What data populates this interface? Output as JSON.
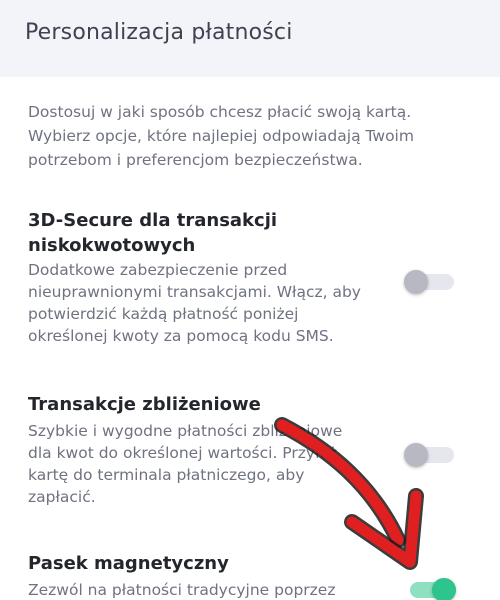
{
  "header": {
    "title": "Personalizacja płatności"
  },
  "intro": {
    "text": "Dostosuj w jaki sposób chcesz płacić swoją kartą. Wybierz opcje, które najlepiej odpowiadają Twoim potrzebom i preferencjom bezpieczeństwa."
  },
  "settings": [
    {
      "title": "3D-Secure dla transakcji niskokwotowych",
      "description": "Dodatkowe zabezpieczenie przed nieuprawnionymi transakcjami. Włącz, aby potwierdzić każdą płatność poniżej określonej kwoty za pomocą kodu SMS.",
      "enabled": false
    },
    {
      "title": "Transakcje zbliżeniowe",
      "description": "Szybkie i wygodne płatności zbliżeniowe dla kwot do określonej wartości. Przyłóż kartę do terminala płatniczego, aby zapłacić.",
      "enabled": false
    },
    {
      "title": "Pasek magnetyczny",
      "description": "Zezwól na płatności tradycyjne poprzez",
      "enabled": true
    }
  ],
  "colors": {
    "accent_on": "#2ec48e",
    "toggle_off": "#b7b8c2",
    "annotation_arrow": "#e02020"
  }
}
